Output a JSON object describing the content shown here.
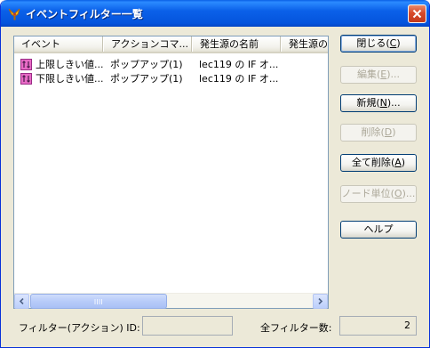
{
  "window": {
    "title": "イベントフィルター一覧",
    "icon": "app-bird-icon",
    "close_icon": "close-icon"
  },
  "list": {
    "columns": [
      "イベント",
      "アクションコマ...",
      "発生源の名前",
      "発生源の"
    ],
    "rows": [
      {
        "event": "上限しきい値...",
        "action": "ポップアップ(1)",
        "source": "lec119 の IF オ...",
        "extra": "",
        "icon": "filter-event-icon"
      },
      {
        "event": "下限しきい値...",
        "action": "ポップアップ(1)",
        "source": "lec119 の IF オ...",
        "extra": "",
        "icon": "filter-event-icon"
      }
    ],
    "scroll_left_icon": "scroll-left-icon",
    "scroll_right_icon": "scroll-right-icon"
  },
  "buttons": {
    "close": {
      "label": "閉じる",
      "key": "C"
    },
    "edit": {
      "label": "編集",
      "key": "E",
      "suffix": "..."
    },
    "new": {
      "label": "新規",
      "key": "N",
      "suffix": "..."
    },
    "delete": {
      "label": "削除",
      "key": "D"
    },
    "delete_all": {
      "label": "全て削除",
      "key": "A"
    },
    "node_unit": {
      "label": "ノード単位",
      "key": "O",
      "suffix": "..."
    },
    "help": {
      "label": "ヘルプ"
    }
  },
  "footer": {
    "filter_id_label": "フィルター(アクション) ID:",
    "filter_id_value": "",
    "total_label": "全フィルター数:",
    "total_value": "2"
  },
  "colors": {
    "titlebar": "#0453dc",
    "window_bg": "#ece9d8",
    "close_button": "#d84a2a",
    "row_icon": "#e86bc6"
  }
}
